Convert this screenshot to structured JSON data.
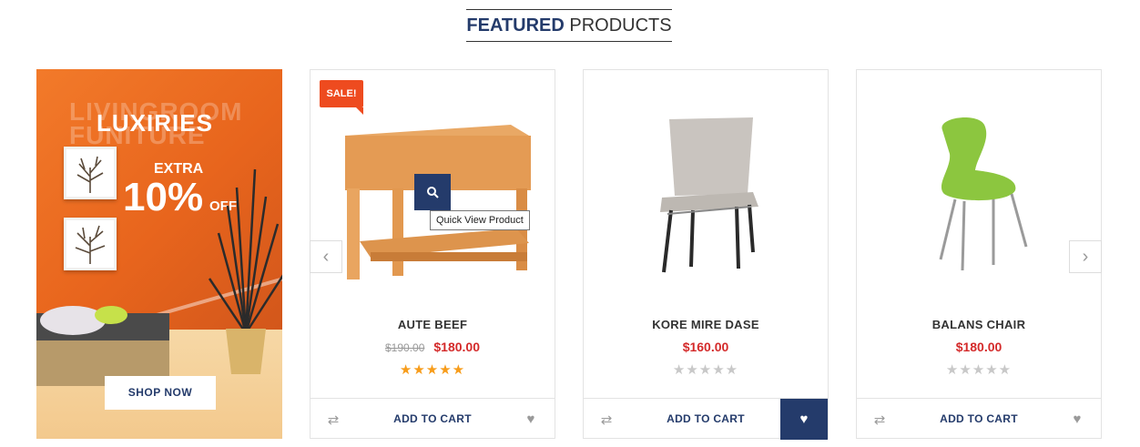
{
  "section": {
    "title_strong": "FEATURED",
    "title_rest": " PRODUCTS"
  },
  "banner": {
    "bg_word_1": "LIVINGROOM",
    "bg_word_2": "FUNITURE",
    "headline": "LUXIRIES",
    "extra": "EXTRA",
    "discount": "10%",
    "off": "OFF",
    "button": "SHOP NOW"
  },
  "products": [
    {
      "name": "AUTE BEEF",
      "old_price": "$190.00",
      "price": "$180.00",
      "rating": 5,
      "badge": "SALE!",
      "add_label": "ADD TO CART"
    },
    {
      "name": "KORE MIRE DASE",
      "old_price": "",
      "price": "$160.00",
      "rating": 0,
      "badge": "",
      "add_label": "ADD TO CART"
    },
    {
      "name": "BALANS CHAIR",
      "old_price": "",
      "price": "$180.00",
      "rating": 0,
      "badge": "",
      "add_label": "ADD TO CART"
    }
  ],
  "quickview": {
    "tooltip": "Quick View Product"
  },
  "icons": {
    "compare": "repeat-icon",
    "wishlist": "heart-icon",
    "quickview": "search-icon",
    "prev": "chevron-left-icon",
    "next": "chevron-right-icon"
  },
  "colors": {
    "brand": "#243b6b",
    "price": "#d42a2a",
    "star": "#f79c1a",
    "sale": "#ee4b1f"
  }
}
